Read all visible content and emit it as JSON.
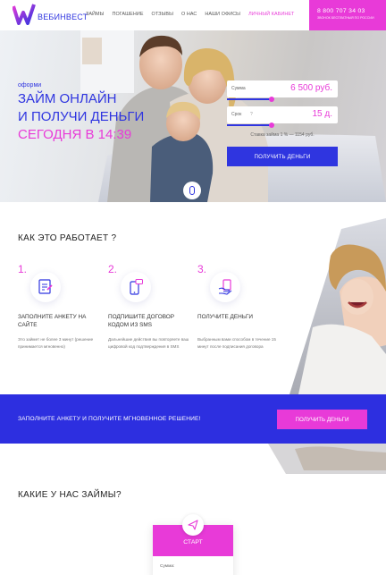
{
  "brand": {
    "logo_text": "ВЕБИНВЕСТ",
    "accent": "#e83ad8",
    "primary": "#2f35e0"
  },
  "nav": {
    "items": [
      "ЗАЙМЫ",
      "ПОГАШЕНИЕ",
      "ОТЗЫВЫ",
      "О НАС",
      "НАШИ ОФИСЫ",
      "ЛИЧНЫЙ КАБИНЕТ"
    ]
  },
  "contact": {
    "phone": "8 800 707 34 03",
    "note": "Звонок бесплатный по России"
  },
  "hero": {
    "small_label": "оформи",
    "line1": "ЗАЙМ ОНЛАЙН",
    "line2": "И ПОЛУЧИ ДЕНЬГИ",
    "line3": "СЕГОДНЯ В 14:39"
  },
  "calculator": {
    "amount_label": "Сумма",
    "amount_value": "6 500 руб.",
    "amount_fraction": 0.4,
    "term_label": "Срок",
    "term_value": "15 д.",
    "term_fraction": 0.4,
    "note": "Ставка займа 1 % — 1154 руб.",
    "submit_label": "ПОЛУЧИТЬ ДЕНЬГИ"
  },
  "how": {
    "title": "КАК ЭТО РАБОТАЕТ ?",
    "steps": [
      {
        "num": "1.",
        "icon": "form-icon",
        "title": "ЗАПОЛНИТЕ АНКЕТУ НА САЙТЕ",
        "desc": "Это займет не более 3 минут (решение принимается мгновенно)"
      },
      {
        "num": "2.",
        "icon": "sms-phone-icon",
        "title": "ПОДПИШИТЕ ДОГОВОР КОДОМ ИЗ SMS",
        "desc": "Дальнейшие действия вы повторяете ваш цифровой код подтверждения в SMS"
      },
      {
        "num": "3.",
        "icon": "money-hand-icon",
        "title": "ПОЛУЧИТЕ ДЕНЬГИ",
        "desc": "Выбранным вами способом в течение 15 минут после подписания договора"
      }
    ]
  },
  "banner": {
    "text": "ЗАПОЛНИТЕ АНКЕТУ И ПОЛУЧИТЕ МГНОВЕННОЕ РЕШЕНИЕ!",
    "button_label": "ПОЛУЧИТЬ ДЕНЬГИ"
  },
  "loans": {
    "title": "КАКИЕ У НАС ЗАЙМЫ?",
    "card": {
      "name": "СТАРТ",
      "label": "Сумма:",
      "icon": "paper-plane-icon"
    }
  }
}
